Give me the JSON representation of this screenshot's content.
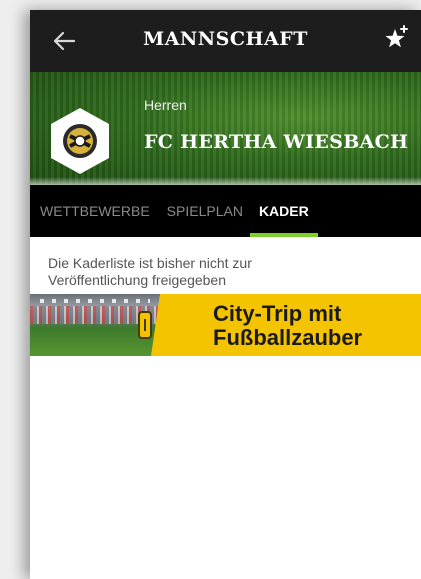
{
  "appbar": {
    "title": "MANNSCHAFT",
    "back_icon": "arrow-left-icon",
    "favorite_icon": "star-plus-icon"
  },
  "team": {
    "category": "Herren",
    "name": "FC HERTHA WIESBACH",
    "badge_icon": "club-crest-icon"
  },
  "tabs": [
    {
      "label": "WETTBEWERBE",
      "active": false
    },
    {
      "label": "SPIELPLAN",
      "active": false
    },
    {
      "label": "KADER",
      "active": true
    }
  ],
  "notice": {
    "line1": "Die Kaderliste ist bisher nicht zur",
    "line2": "Veröffentlichung freigegeben"
  },
  "ad": {
    "line1": "City-Trip mit",
    "line2": "Fußballzauber"
  },
  "colors": {
    "appbar": "#1d1d1d",
    "tab_indicator": "#7dcf2d",
    "ad_background": "#f5c400"
  }
}
